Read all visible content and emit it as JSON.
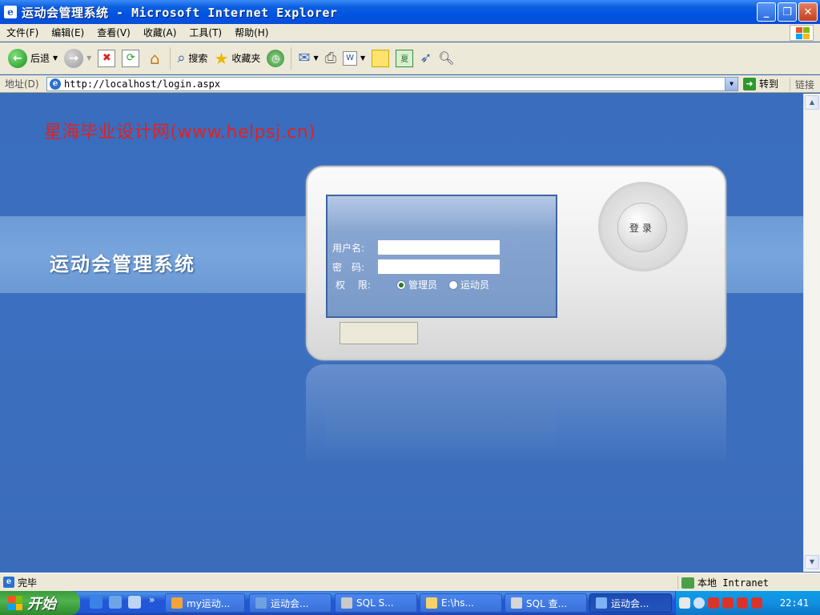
{
  "window": {
    "title": "运动会管理系统 - Microsoft Internet Explorer",
    "buttons": [
      "minimize",
      "restore",
      "close"
    ]
  },
  "menu": [
    "文件(F)",
    "编辑(E)",
    "查看(V)",
    "收藏(A)",
    "工具(T)",
    "帮助(H)"
  ],
  "toolbar": {
    "back_label": "后退",
    "search_label": "搜索",
    "favorites_label": "收藏夹"
  },
  "address": {
    "label": "地址(D)",
    "url": "http://localhost/login.aspx",
    "go_label": "转到",
    "links_label": "链接"
  },
  "page": {
    "watermark": "星海毕业设计网(www.helpsj.cn)",
    "system_title": "运动会管理系统",
    "login_button": "登录",
    "form": {
      "username_label": "用户名:",
      "password_label": "密　码:",
      "permission_label": "权　 限:",
      "username_value": "",
      "password_value": "",
      "roles": [
        "管理员",
        "运动员"
      ],
      "selected_role": "管理员"
    }
  },
  "status": {
    "text": "完毕",
    "zone": "本地 Intranet"
  },
  "taskbar": {
    "start_label": "开始",
    "tasks": [
      "my运动...",
      "运动会...",
      "SQL S...",
      "E:\\hs...",
      "SQL 查...",
      "运动会..."
    ],
    "active_task_index": 5,
    "clock": "22:41"
  },
  "colors": {
    "page_background": "#3a6cb8",
    "watermark": "#e22020",
    "band": "#78a5dc"
  }
}
